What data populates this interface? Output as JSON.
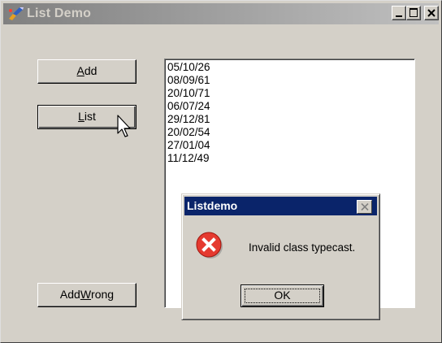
{
  "window": {
    "title": "List Demo"
  },
  "buttons": {
    "add": {
      "pre": "",
      "accel": "A",
      "post": "dd"
    },
    "list": {
      "pre": "",
      "accel": "L",
      "post": "ist"
    },
    "add_wrong": {
      "pre": "Add ",
      "accel": "W",
      "post": "rong"
    }
  },
  "listbox": {
    "items": [
      "05/10/26",
      "08/09/61",
      "20/10/71",
      "06/07/24",
      "29/12/81",
      "20/02/54",
      "27/01/04",
      "11/12/49"
    ]
  },
  "dialog": {
    "title": "Listdemo",
    "message": "Invalid class typecast.",
    "ok_label": "OK",
    "icon": "error-icon"
  },
  "colors": {
    "face": "#d4d0c8",
    "dialog_title": "#0a246a",
    "error_red": "#e53a30"
  }
}
